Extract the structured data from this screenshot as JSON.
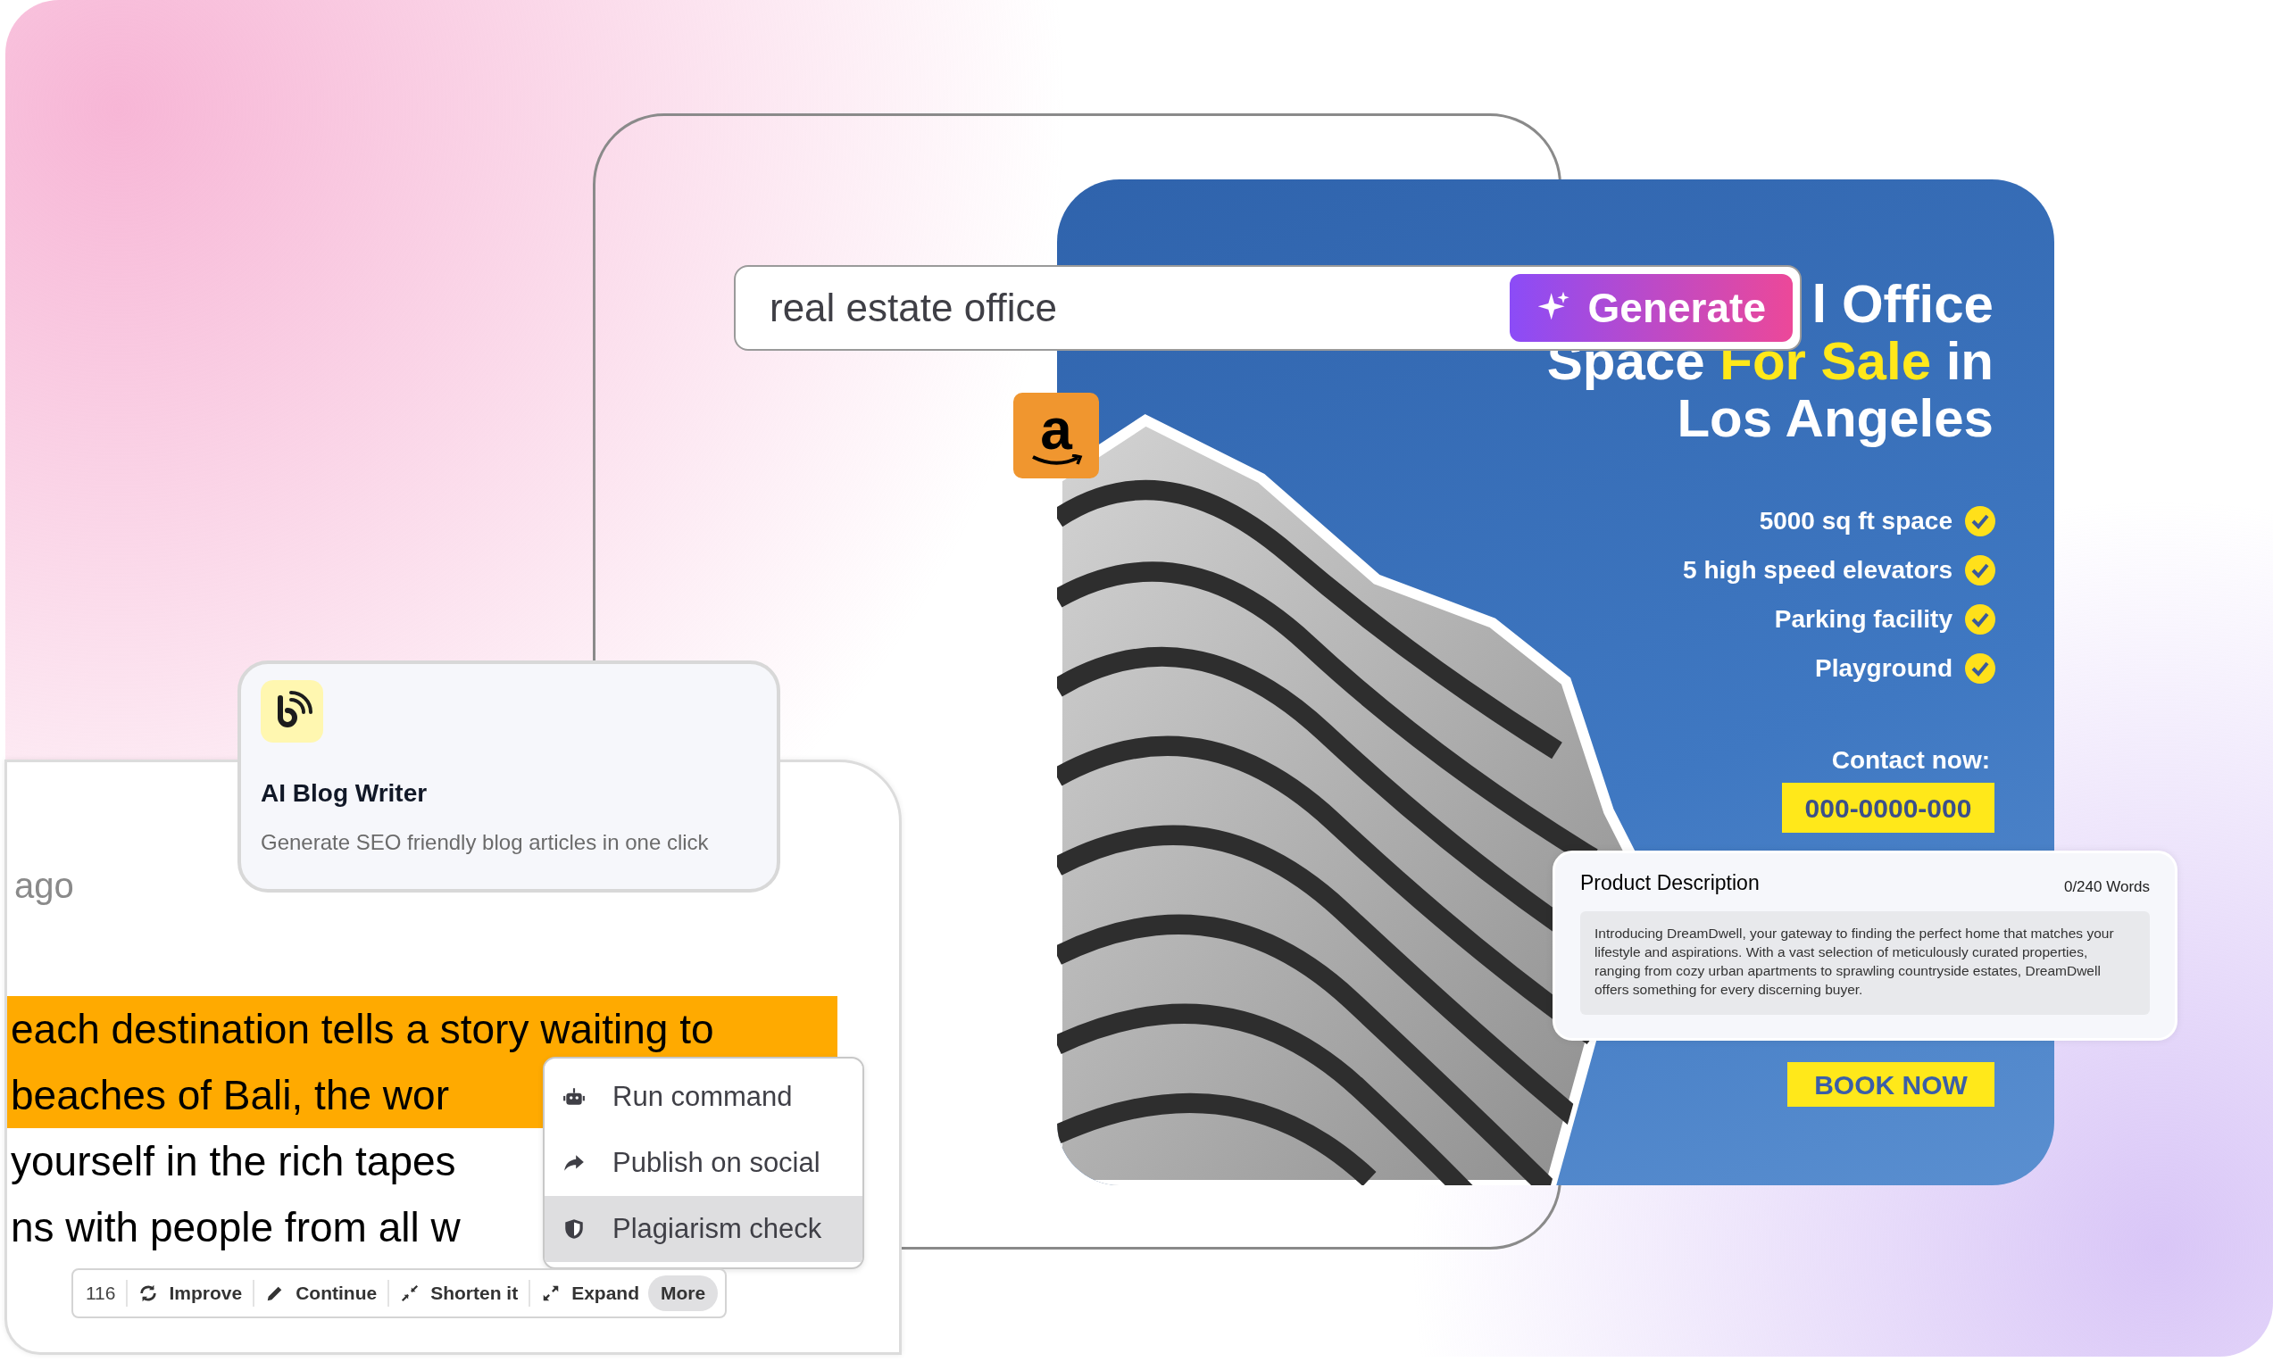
{
  "prompt_bar": {
    "value": "real estate office",
    "button": "Generate"
  },
  "marketplace_badge": {
    "letter": "a"
  },
  "ad": {
    "headline": [
      {
        "segments": [
          {
            "text": "l Office",
            "accent": false
          }
        ]
      },
      {
        "segments": [
          {
            "text": "Space ",
            "accent": false
          },
          {
            "text": "For Sale",
            "accent": true
          },
          {
            "text": " in",
            "accent": false
          }
        ]
      },
      {
        "segments": [
          {
            "text": "Los Angeles",
            "accent": false
          }
        ]
      }
    ],
    "features": [
      "5000 sq ft space",
      "5 high speed elevators",
      "Parking facility",
      "Playground"
    ],
    "contact_label": "Contact now:",
    "phone": "000-0000-000",
    "cta": "BOOK NOW"
  },
  "product_description": {
    "title": "Product Description",
    "counter": "0/240 Words",
    "text": "Introducing DreamDwell, your gateway to finding the perfect home that matches your lifestyle and aspirations. With a vast selection of meticulously curated properties, ranging from cozy urban apartments to sprawling countryside estates, DreamDwell offers something for every discerning buyer."
  },
  "blog_tool": {
    "title": "AI Blog Writer",
    "description": "Generate SEO friendly blog articles in one click"
  },
  "editor": {
    "timestamp": "ago",
    "lines": [
      {
        "text": "each destination tells a story waiting to",
        "highlighted": true
      },
      {
        "text": "beaches of Bali, the wor",
        "highlighted": true
      },
      {
        "text": "yourself in the rich tapes",
        "highlighted": false
      },
      {
        "text": "ns with people from all w",
        "highlighted": false
      }
    ],
    "context_menu": [
      {
        "label": "Run command",
        "selected": false
      },
      {
        "label": "Publish on social",
        "selected": false
      },
      {
        "label": "Plagiarism check",
        "selected": true
      }
    ],
    "toolbar": {
      "count": "116",
      "actions": [
        "Improve",
        "Continue",
        "Shorten it",
        "Expand"
      ],
      "more": "More"
    }
  }
}
